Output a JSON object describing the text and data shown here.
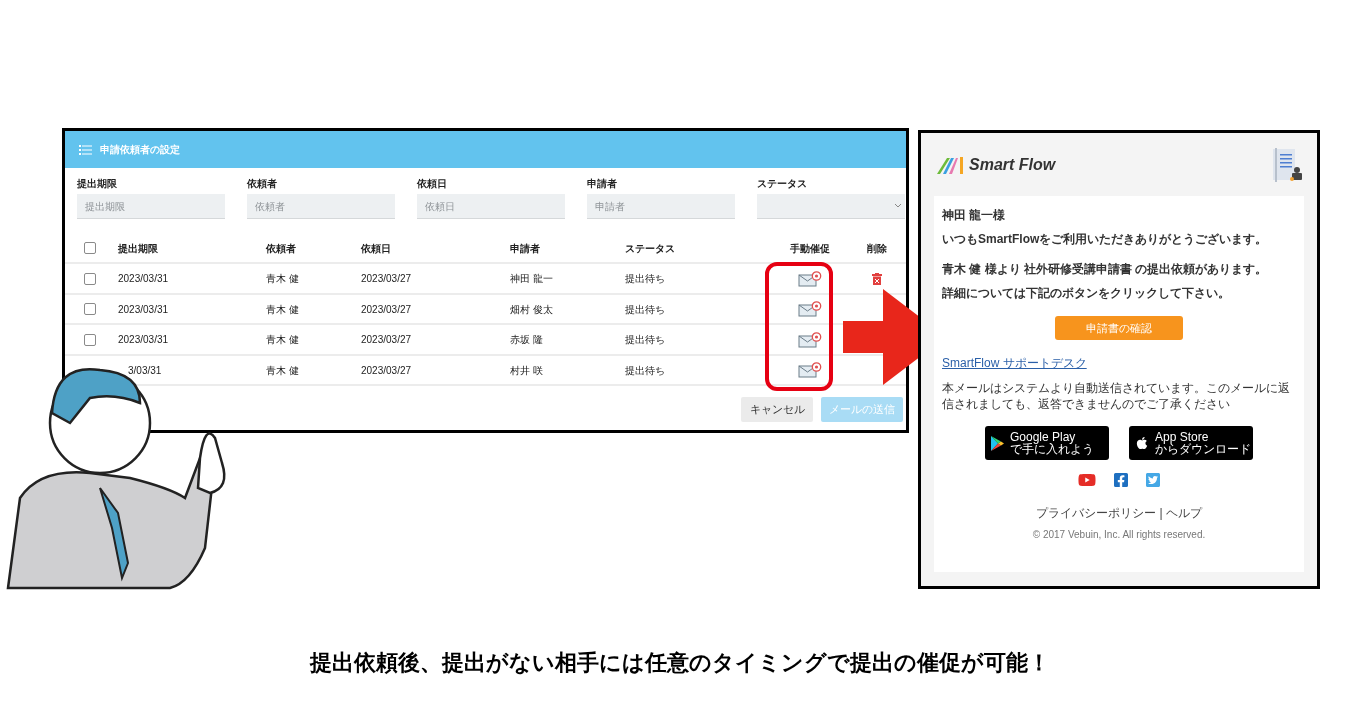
{
  "admin_panel": {
    "title": "申請依頼者の設定",
    "filters": [
      {
        "kind": "text",
        "label": "提出期限",
        "placeholder": "提出期限"
      },
      {
        "kind": "text",
        "label": "依頼者",
        "placeholder": "依頼者"
      },
      {
        "kind": "text",
        "label": "依頼日",
        "placeholder": "依頼日"
      },
      {
        "kind": "text",
        "label": "申請者",
        "placeholder": "申請者"
      },
      {
        "kind": "select",
        "label": "ステータス"
      }
    ],
    "table": {
      "select_all_checked": false,
      "columns": [
        "提出期限",
        "依頼者",
        "依頼日",
        "申請者",
        "ステータス",
        "手動催促",
        "削除"
      ],
      "rows": [
        {
          "checked": false,
          "delete_icon": true,
          "cells": [
            "2023/03/31",
            "青木 健",
            "2023/03/27",
            "神田 龍一",
            "提出待ち"
          ]
        },
        {
          "checked": false,
          "cells": [
            "2023/03/31",
            "青木 健",
            "2023/03/27",
            "畑村 俊太",
            "提出待ち"
          ]
        },
        {
          "checked": false,
          "cells": [
            "2023/03/31",
            "青木 健",
            "2023/03/27",
            "赤坂 隆",
            "提出待ち"
          ]
        },
        {
          "cells": [
            "3/03/31",
            "青木 健",
            "2023/03/27",
            "村井 咲",
            "提出待ち"
          ]
        }
      ]
    },
    "buttons": [
      {
        "kind": "cancel",
        "label": "キャンセル"
      },
      {
        "kind": "send",
        "label": "メールの送信",
        "disabled": true
      }
    ]
  },
  "email": {
    "logo": "Smart Flow",
    "greeting": "神田 龍一様",
    "lines": [
      "いつもSmartFlowをご利用いただきありがとうございます。",
      "青木 健 様より 社外研修受講申請書 の提出依頼があります。",
      "詳細については下記のボタンをクリックして下さい。"
    ],
    "button": "申請書の確認",
    "link": "SmartFlow サポートデスク",
    "notice": "本メールはシステムより自動送信されています。このメールに返信されましても、返答できませんのでご了承ください",
    "stores": [
      {
        "kind": "google",
        "title": "Google Play",
        "subtitle": "で手に入れよう"
      },
      {
        "kind": "apple",
        "title": "App Store",
        "subtitle": "からダウンロード"
      }
    ],
    "social": [
      {
        "kind": "youtube"
      },
      {
        "kind": "facebook"
      },
      {
        "kind": "twitter"
      }
    ],
    "footer_links": "プライバシーポリシー | ヘルプ",
    "copyright": "© 2017 Vebuin, Inc. All rights reserved."
  },
  "caption": "提出依頼後、提出がない相手には任意のタイミングで提出の催促が可能！"
}
